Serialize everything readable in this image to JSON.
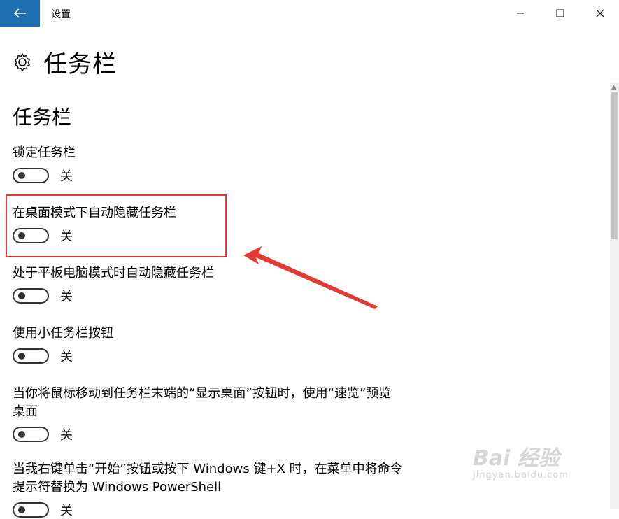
{
  "window": {
    "app_title": "设置",
    "controls": {
      "minimize_icon": "minimize-icon",
      "maximize_icon": "maximize-icon",
      "close_icon": "close-icon"
    }
  },
  "page": {
    "title": "任务栏",
    "icon": "gear-icon"
  },
  "section": {
    "title": "任务栏",
    "settings": [
      {
        "label": "锁定任务栏",
        "state": "关"
      },
      {
        "label": "在桌面模式下自动隐藏任务栏",
        "state": "关"
      },
      {
        "label": "处于平板电脑模式时自动隐藏任务栏",
        "state": "关"
      },
      {
        "label": "使用小任务栏按钮",
        "state": "关"
      },
      {
        "label": "当你将鼠标移动到任务栏末端的“显示桌面”按钮时，使用“速览”预览桌面",
        "state": "关"
      },
      {
        "label": "当我右键单击“开始”按钮或按下 Windows 键+X 时，在菜单中将命令提示符替换为 Windows PowerShell",
        "state": "关"
      }
    ]
  },
  "annotation": {
    "highlight_color": "#e53935"
  },
  "watermark": {
    "brand": "Bai 经验",
    "url": "jingyan.baidu.com"
  },
  "colors": {
    "accent": "#1d6fb1"
  }
}
